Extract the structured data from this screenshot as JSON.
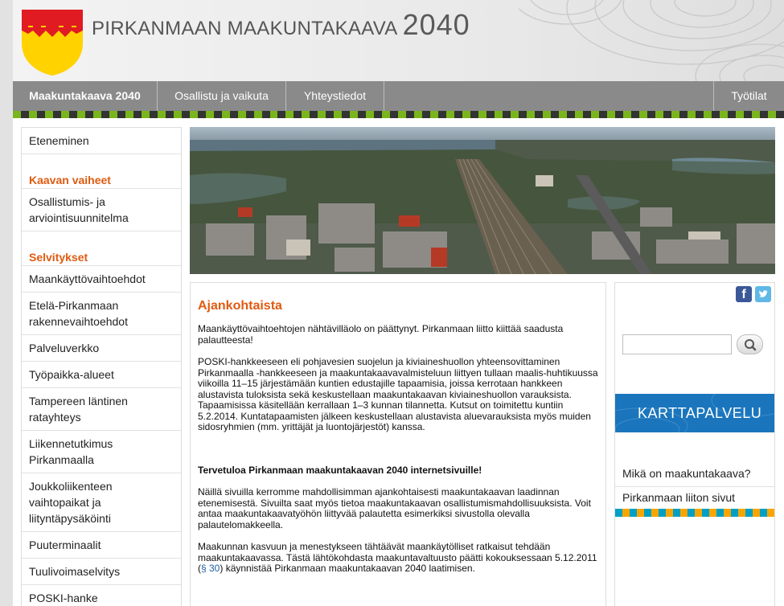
{
  "header": {
    "title_main": "PIRKANMAAN MAAKUNTAKAAVA",
    "title_year": "2040"
  },
  "nav": {
    "items": [
      {
        "label": "Maakuntakaava 2040"
      },
      {
        "label": "Osallistu ja vaikuta"
      },
      {
        "label": "Yhteystiedot"
      }
    ],
    "right_item": "Työtilat"
  },
  "sidebar": {
    "top_link": "Eteneminen",
    "section1_heading": "Kaavan vaiheet",
    "section1_links": [
      "Osallistumis- ja arviointisuunnitelma"
    ],
    "section2_heading": "Selvitykset",
    "section2_links": [
      "Maankäyttövaihtoehdot",
      "Etelä-Pirkanmaan rakennevaihtoehdot",
      "Palveluverkko",
      "Työpaikka-alueet",
      "Tampereen läntinen ratayhteys",
      "Liikennetutkimus Pirkanmaalla",
      "Joukkoliikenteen vaihtopaikat ja liityntäpysäköinti",
      "Puuterminaalit",
      "Tuulivoimaselvitys",
      "POSKI-hanke"
    ]
  },
  "content": {
    "heading": "Ajankohtaista",
    "p1": "Maankäyttövaihtoehtojen nähtävilläolo on päättynyt. Pirkanmaan liitto kiittää saadusta palautteesta!",
    "p2": "POSKI-hankkeeseen eli pohjavesien suojelun ja kiviaineshuollon yhteensovittaminen Pirkanmaalla -hankkeeseen ja maakuntakaavavalmisteluun liittyen tullaan maalis-huhtikuussa viikoilla 11–15 järjestämään kuntien edustajille tapaamisia, joissa kerrotaan hankkeen alustavista tuloksista sekä keskustellaan maakuntakaavan kiviaineshuollon varauksista. Tapaamisissa käsitellään kerrallaan 1–3 kunnan tilannetta. Kutsut on toimitettu kuntiin 5.2.2014. Kuntatapaamisten jälkeen keskustellaan alustavista aluevarauksista myös muiden sidosryhmien (mm. yrittäjät ja luontojärjestöt) kanssa.",
    "welcome_heading": "Tervetuloa Pirkanmaan maakuntakaavan 2040 internetsivuille!",
    "p3": "Näillä sivuilla kerromme mahdollisimman ajankohtaisesti maakuntakaavan laadinnan etenemisestä. Sivuilta saat myös tietoa maakuntakaavan osallistumismahdollisuuksista. Voit antaa maakuntakaavatyöhön liittyvää palautetta esimerkiksi sivustolla olevalla palautelomakkeella.",
    "p4_before": "Maakunnan kasvuun ja menestykseen tähtäävät maankäytölliset ratkaisut tehdään maakuntakaavassa. Tästä lähtökohdasta maakuntavaltuusto päätti kokouksessaan 5.12.2011 (",
    "p4_link": "§ 30",
    "p4_after": ") käynnistää Pirkanmaan maakuntakaavan 2040 laatimisen."
  },
  "right": {
    "facebook_icon": "f",
    "twitter_icon": "t",
    "search_placeholder": "",
    "karttapalvelu_label": "KARTTAPALVELU",
    "links": [
      "Mikä on maakuntakaava?",
      "Pirkanmaan liiton sivut"
    ]
  },
  "colors": {
    "accent_orange": "#e05a10",
    "nav_gray": "#8a8a8a",
    "crest_red": "#e01b22",
    "crest_yellow": "#ffd200",
    "link_blue": "#1b5fa8",
    "kartta_blue": "#1a75bc"
  }
}
